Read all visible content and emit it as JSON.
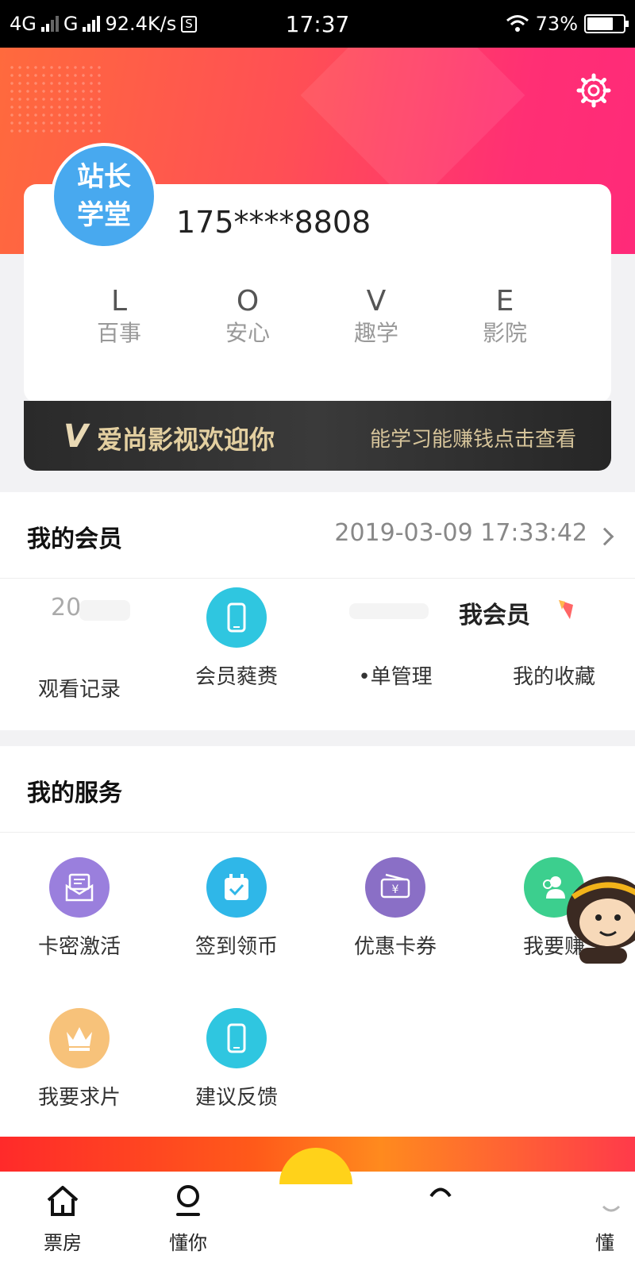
{
  "status_bar": {
    "network1": "4G",
    "network2": "G",
    "speed": "92.4K/s",
    "sim_badge": "S",
    "time": "17:37",
    "battery_percent": "73%",
    "battery_level": 0.73
  },
  "colors": {
    "header_start": "#ff6a3d",
    "header_end": "#ff2a79",
    "avatar_bg": "#48a9ef",
    "banner_text": "#e3cfa0"
  },
  "header": {
    "settings_icon": "gear-icon"
  },
  "profile": {
    "avatar_line1": "站长",
    "avatar_line2": "学堂",
    "phone": "175****8808",
    "love": [
      {
        "letter": "L",
        "word": "百事"
      },
      {
        "letter": "O",
        "word": "安心"
      },
      {
        "letter": "V",
        "word": "趣学"
      },
      {
        "letter": "E",
        "word": "影院"
      }
    ]
  },
  "banner": {
    "logo": "V",
    "welcome": "爱尚影视欢迎你",
    "cta": "能学习能赚钱点击查看"
  },
  "membership": {
    "title": "我的会员",
    "expire": "2019-03-09 17:33:42",
    "fragment_year": "20",
    "fragment_member": "我会员",
    "items": [
      {
        "label": "观看记录",
        "icon": "history-icon"
      },
      {
        "label": "会员蕤赉",
        "icon": "phone-icon"
      },
      {
        "label": "•单管理",
        "icon": "order-icon"
      },
      {
        "label": "我的收藏",
        "icon": "bookmark-icon"
      }
    ]
  },
  "services": {
    "title": "我的服务",
    "items": [
      {
        "label": "卡密激活",
        "icon": "envelope-icon",
        "color": "#9a7fdd"
      },
      {
        "label": "签到领币",
        "icon": "calendar-check-icon",
        "color": "#2fb7e8"
      },
      {
        "label": "优惠卡券",
        "icon": "coupon-icon",
        "color": "#8a6fc6"
      },
      {
        "label": "我要赚",
        "icon": "user-group-icon",
        "color": "#3ccf8e"
      },
      {
        "label": "我要求片",
        "icon": "crown-icon",
        "color": "#f7c27a"
      },
      {
        "label": "建议反馈",
        "icon": "phone-feedback-icon",
        "color": "#2fc6e0"
      }
    ]
  },
  "tabbar": {
    "items": [
      {
        "label": "票房",
        "icon": "home-icon"
      },
      {
        "label": "懂你",
        "icon": "user-icon"
      },
      {
        "label": "懂",
        "icon": "user-icon"
      }
    ]
  }
}
